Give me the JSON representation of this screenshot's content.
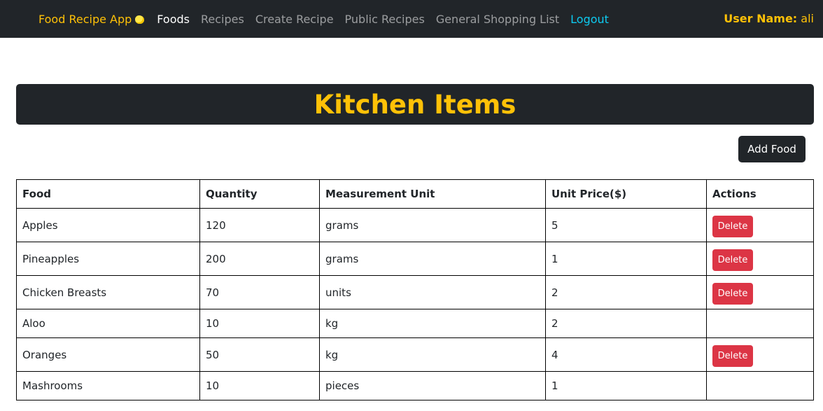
{
  "nav": {
    "brand": "Food Recipe App",
    "links": [
      "Foods",
      "Recipes",
      "Create Recipe",
      "Public Recipes",
      "General Shopping List",
      "Logout"
    ],
    "user_label": "User Name:",
    "user_value": "ali"
  },
  "page": {
    "title": "Kitchen Items",
    "add_button": "Add Food"
  },
  "table": {
    "headers": [
      "Food",
      "Quantity",
      "Measurement Unit",
      "Unit Price($)",
      "Actions"
    ],
    "delete_label": "Delete",
    "rows": [
      {
        "food": "Apples",
        "quantity": "120",
        "unit": "grams",
        "price": "5",
        "deletable": true
      },
      {
        "food": "Pineapples",
        "quantity": "200",
        "unit": "grams",
        "price": "1",
        "deletable": true
      },
      {
        "food": "Chicken Breasts",
        "quantity": "70",
        "unit": "units",
        "price": "2",
        "deletable": true
      },
      {
        "food": "Aloo",
        "quantity": "10",
        "unit": "kg",
        "price": "2",
        "deletable": false
      },
      {
        "food": "Oranges",
        "quantity": "50",
        "unit": "kg",
        "price": "4",
        "deletable": true
      },
      {
        "food": "Mashrooms",
        "quantity": "10",
        "unit": "pieces",
        "price": "1",
        "deletable": false
      }
    ]
  },
  "colors": {
    "dark": "#212529",
    "accent": "#ffc107",
    "danger": "#dc3545",
    "link_info": "#0dcaf0"
  }
}
